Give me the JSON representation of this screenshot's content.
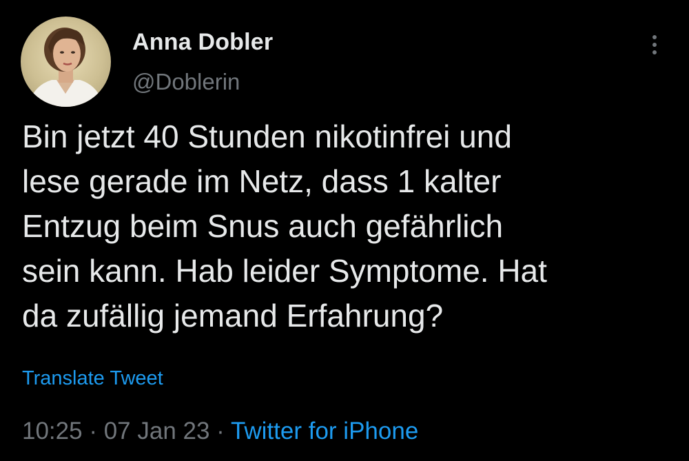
{
  "author": {
    "display_name": "Anna Dobler",
    "handle": "@Doblerin",
    "avatar_icon": "profile-photo-avatar"
  },
  "header": {
    "more_icon": "more-vertical-icon"
  },
  "tweet": {
    "text": "Bin jetzt 40 Stunden nikotinfrei und\nlese gerade im Netz, dass 1 kalter\nEntzug beim Snus auch gefährlich\nsein kann. Hab leider Symptome. Hat\nda zufällig jemand Erfahrung?",
    "translate_label": "Translate Tweet",
    "time": "10:25",
    "separator": " · ",
    "date": "07 Jan 23",
    "source": "Twitter for iPhone"
  },
  "colors": {
    "background": "#000000",
    "text_primary": "#e7e9ea",
    "text_secondary": "#71767b",
    "link": "#1d9bf0"
  }
}
